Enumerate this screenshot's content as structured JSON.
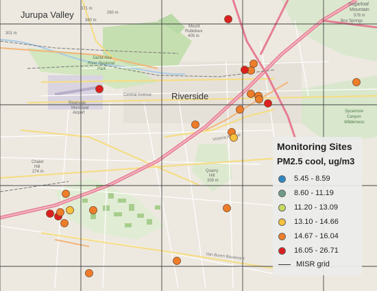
{
  "map": {
    "places": {
      "jurupa_valley": "Jurupa Valley",
      "riverside": "Riverside",
      "santa_ana_park_1": "Santa Ana",
      "santa_ana_park_2": "River Regional",
      "santa_ana_park_3": "Park",
      "airport_1": "Riverside",
      "airport_2": "Municipal",
      "airport_3": "Airport",
      "sugarloaf": "Sugarloaf",
      "mountain": "Mountain",
      "sugarloaf_elev": "578 m",
      "sycamore_1": "Sycamore",
      "sycamore_2": "Canyon",
      "sycamore_3": "Wilderness",
      "quarry_1": "Quarry",
      "quarry_2": "Hill",
      "quarry_elev": "339 m",
      "chalet_1": "Chalet",
      "chalet_2": "Hill",
      "chalet_elev": "274 m",
      "box_springs": "Box Springs",
      "mt_rubidoux_1": "Mount",
      "mt_rubidoux_2": "Rubidoux",
      "mt_rubidoux_elev": "405 m",
      "elev_371": "371 m",
      "elev_360": "360 m",
      "elev_260": "260 m",
      "elev_301": "301 m",
      "van_buren": "Van Buren Boulevard",
      "central_ave": "Central Avenue",
      "victoria_ave": "Victoria Avenue"
    },
    "sites": [
      {
        "pm25_bin": 5
      },
      {
        "pm25_bin": 4
      },
      {
        "pm25_bin": 4
      },
      {
        "pm25_bin": 5
      },
      {
        "pm25_bin": 4
      },
      {
        "pm25_bin": 5
      },
      {
        "pm25_bin": 4
      },
      {
        "pm25_bin": 4
      },
      {
        "pm25_bin": 4
      },
      {
        "pm25_bin": 5
      },
      {
        "pm25_bin": 4
      },
      {
        "pm25_bin": 4
      },
      {
        "pm25_bin": 4
      },
      {
        "pm25_bin": 3
      },
      {
        "pm25_bin": 4
      },
      {
        "pm25_bin": 5
      },
      {
        "pm25_bin": 5
      },
      {
        "pm25_bin": 4
      },
      {
        "pm25_bin": 3
      },
      {
        "pm25_bin": 4
      },
      {
        "pm25_bin": 4
      },
      {
        "pm25_bin": 4
      },
      {
        "pm25_bin": 4
      },
      {
        "pm25_bin": 4
      }
    ]
  },
  "legend": {
    "title": "Monitoring Sites",
    "subtitle": "PM2.5 cool, ug/m3",
    "classes": [
      {
        "label": "5.45 - 8.59",
        "color": "#2f86c2"
      },
      {
        "label": "8.60 - 11.19",
        "color": "#6e9e87"
      },
      {
        "label": "11.20 - 13.09",
        "color": "#c8d860"
      },
      {
        "label": "13.10 - 14.66",
        "color": "#f6c23e"
      },
      {
        "label": "14.67 - 16.04",
        "color": "#ee7d2a"
      },
      {
        "label": "16.05 - 26.71",
        "color": "#dc1f1f"
      }
    ],
    "grid_label": "MISR grid"
  }
}
